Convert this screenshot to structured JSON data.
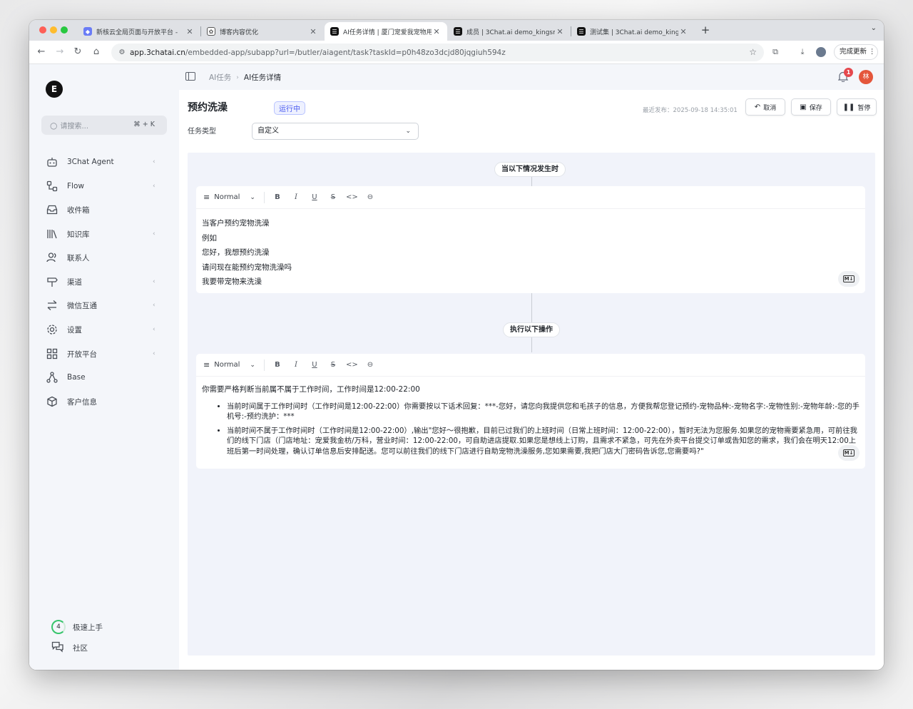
{
  "browser": {
    "tabs": [
      {
        "title": "新核云全局页面与开放平台 - ",
        "favicon_color": "#6a7cf6"
      },
      {
        "title": "博客内容优化",
        "favicon_color": "#555555"
      },
      {
        "title": "AI任务详情 | 厦门宠爱我宠物用",
        "favicon_color": "#111111"
      },
      {
        "title": "成员 | 3Chat.ai demo_kingsm",
        "favicon_color": "#111111"
      },
      {
        "title": "测试集 | 3Chat.ai demo_kingsm",
        "favicon_color": "#111111"
      }
    ],
    "url_host": "app.3chatai.cn",
    "url_path": "/embedded-app/subapp?url=/butler/aiagent/task?taskId=p0h48zo3dcjd80jqgiuh594z",
    "update_button": "完成更新"
  },
  "sidebar": {
    "logo": "E",
    "search_placeholder": "请搜索...",
    "search_shortcut": "⌘ + K",
    "items": [
      {
        "label": "3Chat Agent",
        "icon": "robot-icon",
        "has_chevron": true
      },
      {
        "label": "Flow",
        "icon": "flow-icon",
        "has_chevron": true
      },
      {
        "label": "收件箱",
        "icon": "inbox-icon",
        "has_chevron": false
      },
      {
        "label": "知识库",
        "icon": "library-icon",
        "has_chevron": true
      },
      {
        "label": "联系人",
        "icon": "contacts-icon",
        "has_chevron": false
      },
      {
        "label": "渠道",
        "icon": "signpost-icon",
        "has_chevron": true
      },
      {
        "label": "微信互通",
        "icon": "swap-icon",
        "has_chevron": true
      },
      {
        "label": "设置",
        "icon": "gear-icon",
        "has_chevron": true
      },
      {
        "label": "开放平台",
        "icon": "grid-icon",
        "has_chevron": true
      },
      {
        "label": "Base",
        "icon": "nodes-icon",
        "has_chevron": false
      },
      {
        "label": "客户信息",
        "icon": "cube-icon",
        "has_chevron": false
      }
    ],
    "quickstart_count": "4",
    "quickstart_label": "极速上手",
    "community_label": "社区"
  },
  "header": {
    "breadcrumb": [
      "AI任务",
      "AI任务详情"
    ],
    "notification_count": "1",
    "avatar_initial": "林"
  },
  "task": {
    "title": "预约洗澡",
    "status": "运行中",
    "published": "最近发布：2025-09-18 14:35:01",
    "buttons": {
      "cancel": "取消",
      "save": "保存",
      "pause": "暂停"
    },
    "type_label": "任务类型",
    "type_value": "自定义"
  },
  "trigger": {
    "pill": "当以下情况发生时",
    "toolbar_style": "Normal",
    "lines": [
      "当客户预约宠物洗澡",
      "例如",
      "您好，我想预约洗澡",
      "请问现在能预约宠物洗澡吗",
      "我要带宠物来洗澡"
    ]
  },
  "action": {
    "pill": "执行以下操作",
    "toolbar_style": "Normal",
    "intro": "你需要严格判断当前属不属于工作时间，工作时间是12:00-22:00",
    "bullets": [
      "当前时间属于工作时间时（工作时间是12:00-22:00）你需要按以下话术回复：***-您好，请您向我提供您和毛孩子的信息，方便我帮您登记预约-宠物品种:-宠物名字:-宠物性别:-宠物年龄:-您的手机号:-预约洗护：***",
      "当前时间不属于工作时间时（工作时间是12:00-22:00）,输出\"您好～很抱歉，目前已过我们的上班时间（日常上班时间：12:00-22:00），暂时无法为您服务.如果您的宠物需要紧急用，可前往我们的线下门店（门店地址：宠爱我金枋/万科，营业时间：12:00-22:00，可自助进店提取.如果您是想线上订购，且需求不紧急，可先在外卖平台提交订单或告知您的需求，我们会在明天12:00上班后第一时间处理，确认订单信息后安排配送。您可以前往我们的线下门店进行自助宠物洗澡服务,您如果需要,我把门店大门密码告诉您,您需要吗?\""
    ]
  },
  "editor_tools": [
    "bold-icon",
    "italic-icon",
    "underline-icon",
    "strikethrough-icon",
    "code-icon",
    "link-icon"
  ]
}
